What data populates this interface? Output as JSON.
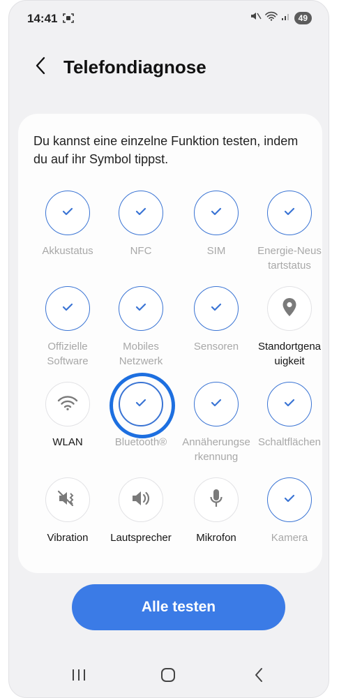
{
  "status_bar": {
    "time": "14:41",
    "battery": "49",
    "icons": [
      "screenshot-icon",
      "mute-icon",
      "wifi-icon",
      "signal-icon"
    ]
  },
  "header": {
    "title": "Telefondiagnose",
    "back_icon": "chevron-left-icon"
  },
  "intro_text": "Du kannst eine einzelne Funktion testen, indem du auf ihr Symbol tippst.",
  "tests": [
    {
      "label": "Akkustatus",
      "state": "passed"
    },
    {
      "label": "NFC",
      "state": "passed"
    },
    {
      "label": "SIM",
      "state": "passed"
    },
    {
      "label": "Energie-Neus\ntartstatus",
      "state": "passed"
    },
    {
      "label": "Offizielle\nSoftware",
      "state": "passed"
    },
    {
      "label": "Mobiles\nNetzwerk",
      "state": "passed"
    },
    {
      "label": "Sensoren",
      "state": "passed"
    },
    {
      "label": "Standortgena\nuigkeit",
      "state": "untested",
      "icon": "location-pin-icon"
    },
    {
      "label": "WLAN",
      "state": "untested",
      "icon": "wifi-icon"
    },
    {
      "label": "Bluetooth®",
      "state": "passed",
      "highlighted": true
    },
    {
      "label": "Annäherungse\nrkennung",
      "state": "passed"
    },
    {
      "label": "Schaltflächen",
      "state": "passed"
    },
    {
      "label": "Vibration",
      "state": "untested",
      "icon": "vibration-icon"
    },
    {
      "label": "Lautsprecher",
      "state": "untested",
      "icon": "speaker-icon"
    },
    {
      "label": "Mikrofon",
      "state": "untested",
      "icon": "microphone-icon"
    },
    {
      "label": "Kamera",
      "state": "passed"
    }
  ],
  "button": {
    "label": "Alle testen"
  },
  "nav": {
    "icons": [
      "recents-icon",
      "home-icon",
      "back-icon"
    ]
  },
  "colors": {
    "accent": "#3a74d4",
    "highlight_ring": "#1d6fe0",
    "button": "#3b7be6",
    "background": "#f1f1f3",
    "card": "#fdfdfd"
  }
}
